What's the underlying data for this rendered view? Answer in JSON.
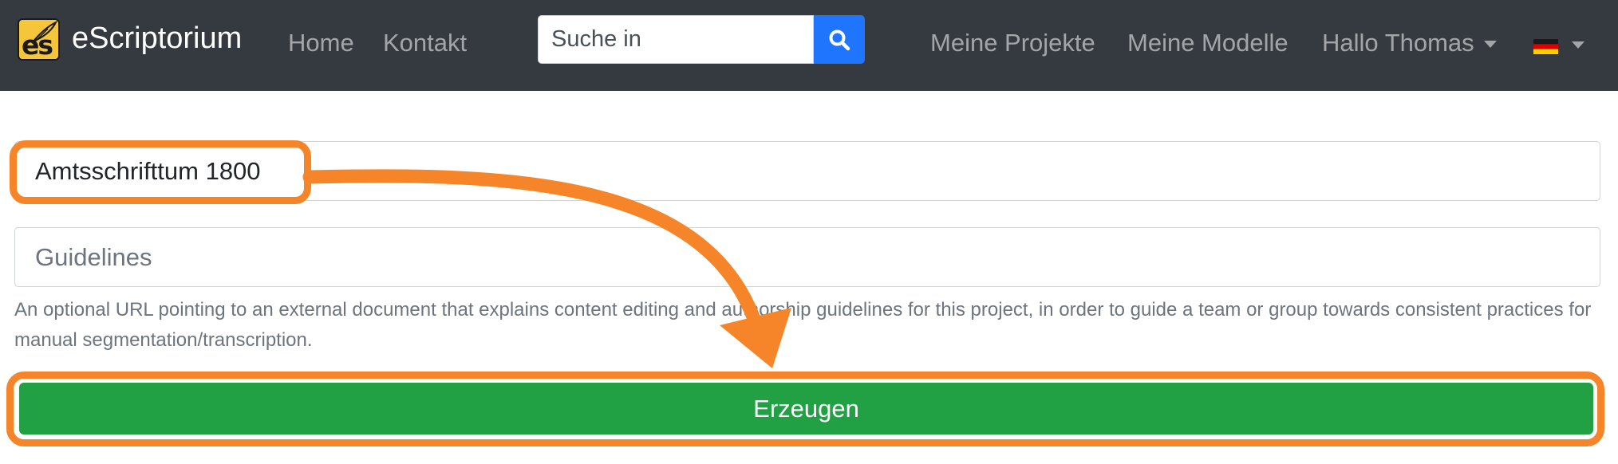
{
  "navbar": {
    "brand": "eScriptorium",
    "logo_text": "es",
    "links": {
      "home": "Home",
      "contact": "Kontakt",
      "projects": "Meine Projekte",
      "models": "Meine Modelle",
      "user": "Hallo Thomas"
    },
    "search": {
      "placeholder": "Suche in",
      "icon": "search-icon"
    },
    "language_icon": "german-flag-icon"
  },
  "form": {
    "name_value": "Amtsschrifttum 1800",
    "guidelines_placeholder": "Guidelines",
    "guidelines_help": "An optional URL pointing to an external document that explains content editing and authorship guidelines for this project, in order to guide a team or group towards consistent practices for manual segmentation/transcription.",
    "submit_label": "Erzeugen"
  },
  "annotation": {
    "color": "#f6852a"
  },
  "colors": {
    "navbar_bg": "#343a40",
    "search_button": "#1f75fe",
    "submit_button": "#21a044",
    "logo_bg": "#f5c53a"
  }
}
